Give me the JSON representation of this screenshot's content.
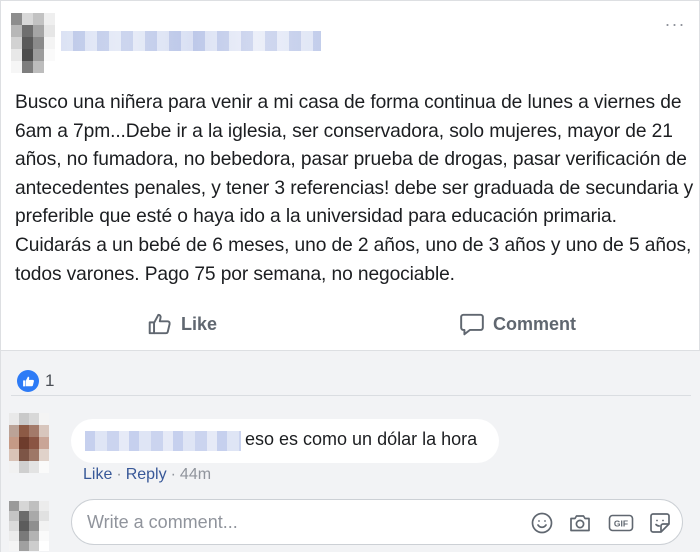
{
  "post": {
    "body": "Busco una niñera para venir a mi casa de forma continua de lunes a viernes de 6am a 7pm...Debe ir a la iglesia, ser conservadora, solo mujeres, mayor de 21 años, no fumadora, no bebedora, pasar prueba de drogas, pasar verificación de antecedentes penales, y tener 3 referencias! debe ser graduada de secundaria y preferible que esté o haya ido a la universidad para educación primaria. Cuidarás a un bebé de 6 meses, uno de 2 años, uno de 3 años y uno de 5 años, todos varones. Pago 75 por semana, no negociable.",
    "more_icon": "···"
  },
  "actions": {
    "like_label": "Like",
    "comment_label": "Comment"
  },
  "reactions": {
    "count": "1"
  },
  "comment": {
    "text": "eso es como un dólar la hora",
    "like_link": "Like",
    "reply_link": "Reply",
    "separator": "·",
    "time": "44m"
  },
  "composer": {
    "placeholder": "Write a comment..."
  },
  "colors": {
    "accent": "#2d7bf6",
    "link": "#385898",
    "muted": "#606770",
    "feedback_bg": "#f2f3f5"
  }
}
